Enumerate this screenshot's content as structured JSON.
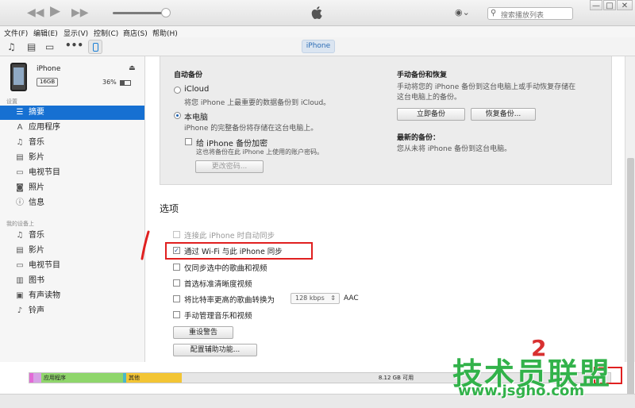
{
  "titlebar": {
    "prev_icon": "rewind-icon",
    "play_icon": "play-icon",
    "next_icon": "fast-forward-icon",
    "apple_icon": "apple-logo-icon",
    "search_placeholder": "搜索播放列表",
    "window_controls": [
      "—",
      "□",
      "✕"
    ]
  },
  "menubar": {
    "items": [
      "文件(F)",
      "编辑(E)",
      "显示(V)",
      "控制(C)",
      "商店(S)",
      "帮助(H)"
    ]
  },
  "toolbar": {
    "device_tab": "iPhone"
  },
  "device": {
    "name": "iPhone",
    "capacity": "16GB",
    "battery": "36%"
  },
  "sidebar": {
    "settings_header": "设置",
    "settings_items": [
      {
        "label": "摘要",
        "icon": "summary-icon",
        "selected": true
      },
      {
        "label": "应用程序",
        "icon": "apps-icon"
      },
      {
        "label": "音乐",
        "icon": "music-icon"
      },
      {
        "label": "影片",
        "icon": "movies-icon"
      },
      {
        "label": "电视节目",
        "icon": "tv-icon"
      },
      {
        "label": "照片",
        "icon": "camera-icon"
      },
      {
        "label": "信息",
        "icon": "info-icon"
      }
    ],
    "ondevice_header": "我的设备上",
    "ondevice_items": [
      {
        "label": "音乐",
        "icon": "music-icon"
      },
      {
        "label": "影片",
        "icon": "movies-icon"
      },
      {
        "label": "电视节目",
        "icon": "tv-icon"
      },
      {
        "label": "图书",
        "icon": "books-icon"
      },
      {
        "label": "有声读物",
        "icon": "audiobooks-icon"
      },
      {
        "label": "铃声",
        "icon": "bell-icon"
      }
    ]
  },
  "backup": {
    "auto_title": "自动备份",
    "icloud_label": "iCloud",
    "icloud_desc": "将您 iPhone 上最重要的数据备份到 iCloud。",
    "local_label": "本电脑",
    "local_desc": "iPhone 的完整备份将存储在这台电脑上。",
    "encrypt_label": "给 iPhone 备份加密",
    "encrypt_desc": "这也将备份在此 iPhone 上使用的账户密码。",
    "change_password": "更改密码...",
    "manual_title": "手动备份和恢复",
    "manual_desc1": "手动将您的 iPhone 备份到这台电脑上或手动恢复存储在",
    "manual_desc2": "这台电脑上的备份。",
    "backup_now": "立即备份",
    "restore_backup": "恢复备份...",
    "latest_title": "最新的备份：",
    "latest_desc": "您从未将 iPhone 备份到这台电脑。"
  },
  "options": {
    "title": "选项",
    "auto_sync": "连接此 iPhone 时自动同步",
    "wifi_sync": "通过 Wi-Fi 与此 iPhone 同步",
    "sync_checked": "仅同步选中的歌曲和视频",
    "prefer_sd": "首选标准清晰度视频",
    "convert_bitrate": "将比特率更高的歌曲转换为",
    "bitrate": "128 kbps",
    "format": "AAC",
    "manual_manage": "手动管理音乐和视频",
    "reset_warnings": "重设警告",
    "accessibility": "配置辅助功能..."
  },
  "capacity_bar": {
    "apps_label": "应用程序",
    "other_label": "其他",
    "free_label": "8.12 GB 可用",
    "colors": {
      "apps": "#8fd66b",
      "other": "#f3c534",
      "free": "#e6e6e6",
      "pink": "#e26bd6",
      "teal": "#4bb8c8"
    }
  },
  "annotations": {
    "mark_1": "1",
    "mark_2": "2"
  },
  "watermark": {
    "text": "技术员联盟",
    "url": "www.jsgho.com"
  }
}
